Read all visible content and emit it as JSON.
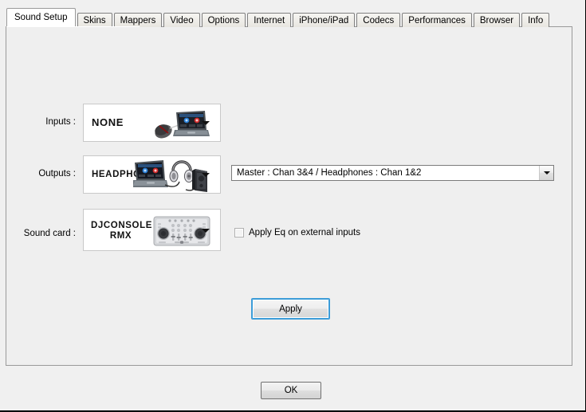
{
  "window": {
    "ok_label": "OK"
  },
  "tabs": [
    {
      "label": "Sound Setup",
      "active": true
    },
    {
      "label": "Skins",
      "active": false
    },
    {
      "label": "Mappers",
      "active": false
    },
    {
      "label": "Video",
      "active": false
    },
    {
      "label": "Options",
      "active": false
    },
    {
      "label": "Internet",
      "active": false
    },
    {
      "label": "iPhone/iPad",
      "active": false
    },
    {
      "label": "Codecs",
      "active": false
    },
    {
      "label": "Performances",
      "active": false
    },
    {
      "label": "Browser",
      "active": false
    },
    {
      "label": "Info",
      "active": false
    }
  ],
  "sound_setup": {
    "inputs": {
      "label": "Inputs :",
      "value": "NONE",
      "artwork": "laptop-mouse-icon"
    },
    "outputs": {
      "label": "Outputs :",
      "value": "HEADPHONES",
      "artwork": "laptop-headphones-speaker-icon",
      "channel_mapping": {
        "selected": "Master : Chan 3&4 / Headphones : Chan 1&2"
      }
    },
    "sound_card": {
      "label": "Sound card :",
      "value_line1": "DJCONSOLE",
      "value_line2": "RMX",
      "artwork": "dj-console-rmx-icon"
    },
    "apply_eq_checkbox": {
      "label": "Apply Eq on external inputs",
      "checked": false
    },
    "apply_button": {
      "label": "Apply"
    }
  },
  "colors": {
    "focus_blue": "#3c9cd8",
    "panel_bg": "#efefef",
    "window_bg": "#f0f0f0"
  }
}
